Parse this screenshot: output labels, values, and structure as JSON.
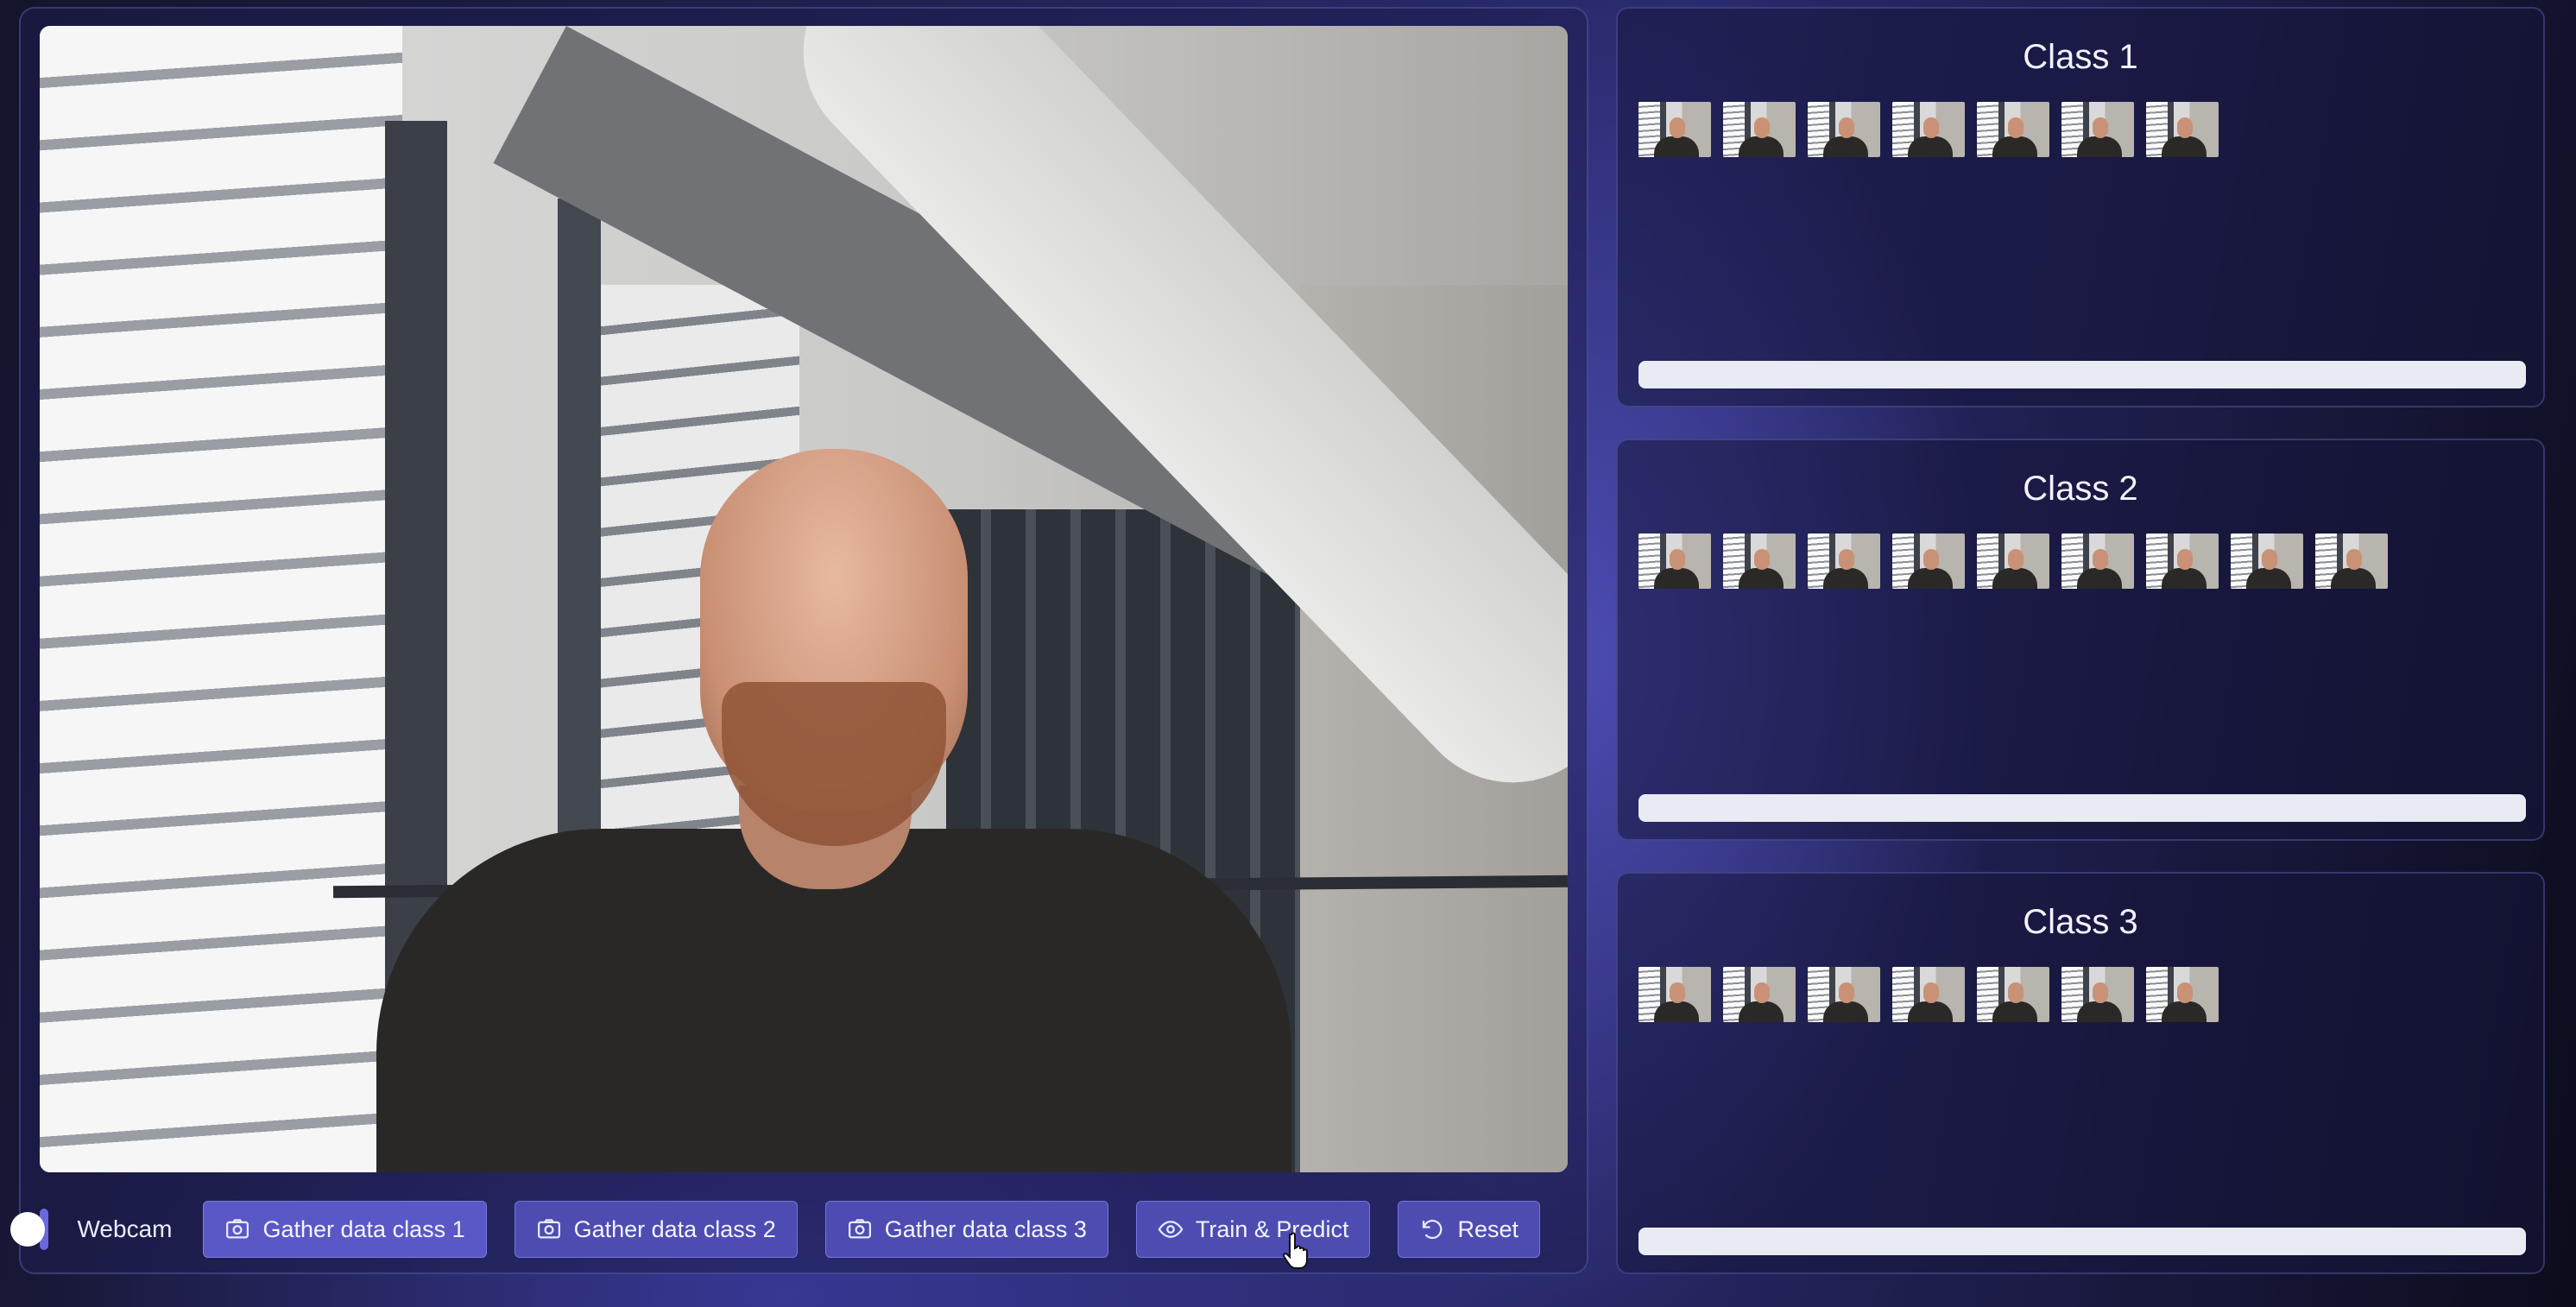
{
  "webcam": {
    "toggle_on": true,
    "label": "Webcam"
  },
  "toolbar": {
    "gather1_label": "Gather data class 1",
    "gather2_label": "Gather data class 2",
    "gather3_label": "Gather data class 3",
    "train_label": "Train & Predict",
    "reset_label": "Reset",
    "icons": {
      "gather": "camera-icon",
      "train": "eye-icon",
      "reset": "undo-icon"
    }
  },
  "classes": [
    {
      "title": "Class 1",
      "sample_count": 7,
      "progress": 0
    },
    {
      "title": "Class 2",
      "sample_count": 9,
      "progress": 0
    },
    {
      "title": "Class 3",
      "sample_count": 7,
      "progress": 0
    }
  ],
  "colors": {
    "accent": "#5a57c7",
    "toggle": "#6b68dd",
    "progress_track": "#e9ebf2"
  }
}
